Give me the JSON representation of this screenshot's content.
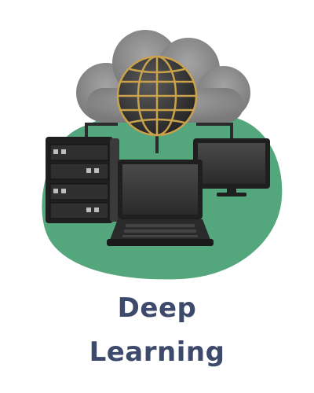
{
  "card": {
    "title_line1": "Deep",
    "title_line2": "Learning"
  },
  "illustration": {
    "icons": [
      "cloud-icon",
      "globe-icon",
      "server-icon",
      "laptop-icon",
      "monitor-icon"
    ]
  },
  "colors": {
    "title": "#3d4a6b",
    "blob": "#54a67d",
    "cloud": "#8a8a8a",
    "device": "#2b2b2b",
    "globe_lines": "#c9a24b"
  }
}
